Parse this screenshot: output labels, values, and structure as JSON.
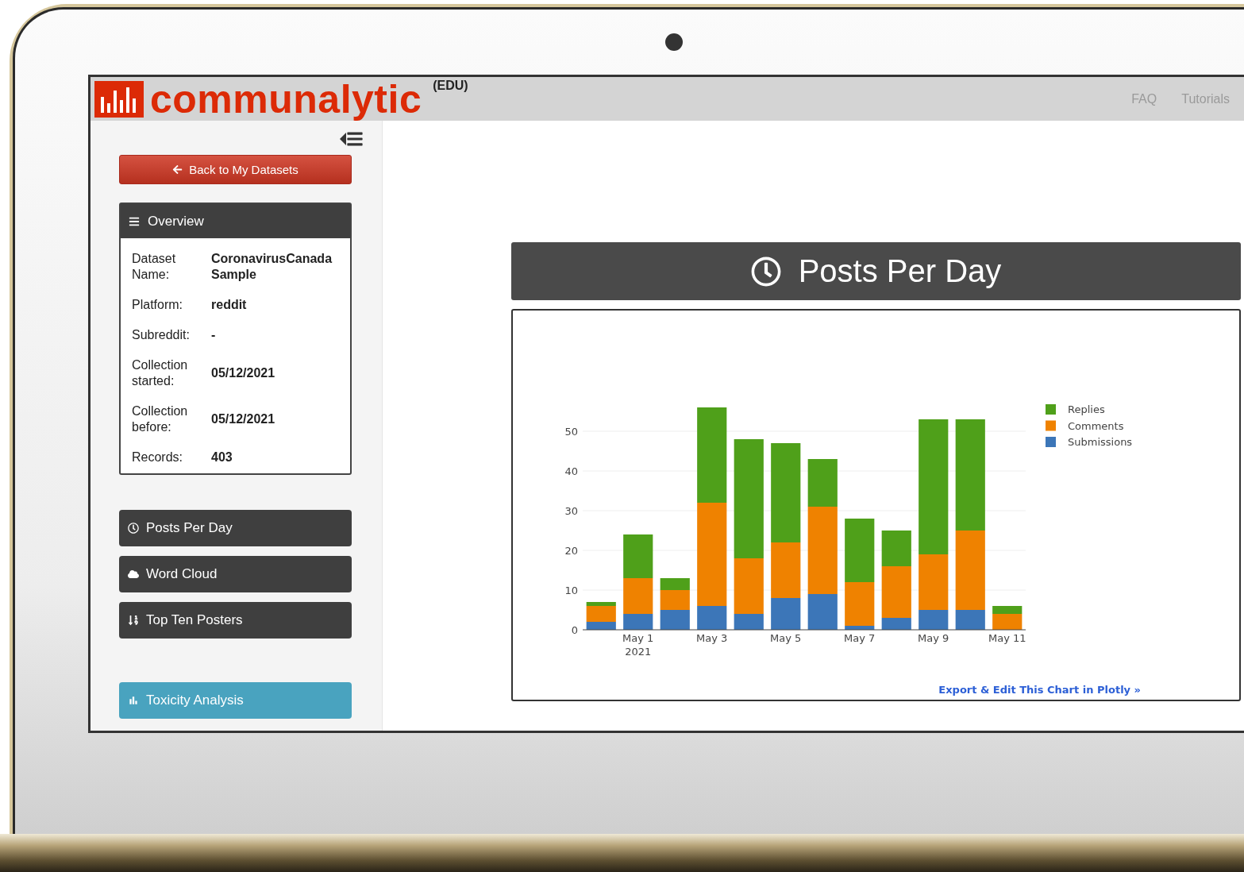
{
  "header": {
    "logo_text": "communalytic",
    "badge": "(EDU)",
    "links": [
      {
        "label": "FAQ"
      },
      {
        "label": "Tutorials"
      }
    ]
  },
  "sidebar": {
    "expanded": true,
    "back_button": "Back to My Datasets",
    "overview": {
      "title": "Overview",
      "rows": [
        {
          "label": "Dataset Name:",
          "value": "CoronavirusCanada Sample"
        },
        {
          "label": "Platform:",
          "value": "reddit"
        },
        {
          "label": "Subreddit:",
          "value": "-"
        },
        {
          "label": "Collection started:",
          "value": "05/12/2021"
        },
        {
          "label": "Collection before:",
          "value": "05/12/2021"
        },
        {
          "label": "Records:",
          "value": "403"
        }
      ]
    },
    "nav": [
      {
        "label": "Posts Per Day",
        "kind": "dark"
      },
      {
        "label": "Word Cloud",
        "kind": "dark"
      },
      {
        "label": "Top Ten Posters",
        "kind": "dark"
      },
      {
        "label": "Toxicity Analysis",
        "kind": "info"
      }
    ]
  },
  "main": {
    "title": "Posts Per Day",
    "chart_data": {
      "type": "bar",
      "stacked": true,
      "x": [
        "2021-04-30",
        "2021-05-01",
        "2021-05-02",
        "2021-05-03",
        "2021-05-04",
        "2021-05-05",
        "2021-05-06",
        "2021-05-07",
        "2021-05-08",
        "2021-05-09",
        "2021-05-10",
        "2021-05-11"
      ],
      "series": [
        {
          "name": "Submissions",
          "color": "#3c76b8",
          "values": [
            2,
            4,
            5,
            6,
            4,
            8,
            9,
            1,
            3,
            5,
            5,
            0
          ]
        },
        {
          "name": "Comments",
          "color": "#ef8200",
          "values": [
            4,
            9,
            5,
            26,
            14,
            14,
            22,
            11,
            13,
            14,
            20,
            4
          ]
        },
        {
          "name": "Replies",
          "color": "#4fa01a",
          "values": [
            1,
            11,
            3,
            24,
            30,
            25,
            12,
            16,
            9,
            34,
            28,
            2
          ]
        }
      ],
      "grid": true,
      "legend": true,
      "xlim": [
        "2021-04-29 12:00",
        "2021-05-11 12:00"
      ],
      "ylim": [
        0,
        56
      ],
      "yticks": [
        0,
        10,
        20,
        30,
        40,
        50
      ],
      "annotations": [
        "2021"
      ],
      "xticks": [
        {
          "value": "2021-05-01",
          "label": "May 1"
        },
        {
          "value": "2021-05-03",
          "label": "May 3"
        },
        {
          "value": "2021-05-05",
          "label": "May 5"
        },
        {
          "value": "2021-05-07",
          "label": "May 7"
        },
        {
          "value": "2021-05-09",
          "label": "May 9"
        },
        {
          "value": "2021-05-11",
          "label": "May 11"
        }
      ]
    },
    "export_link": "Export & Edit This Chart in Plotly »"
  }
}
